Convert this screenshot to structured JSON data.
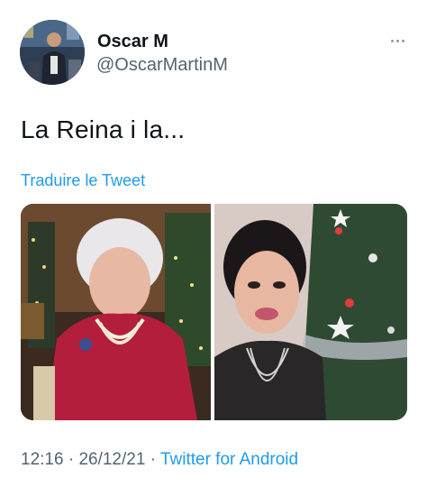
{
  "author": {
    "name": "Oscar M",
    "handle": "@OscarMartinM"
  },
  "tweet": {
    "text": "La Reina i la...",
    "translate_label": "Traduire le Tweet"
  },
  "footer": {
    "time": "12:16",
    "separator": " · ",
    "date": "26/12/21",
    "source": "Twitter for Android"
  },
  "icons": {
    "more": "more-dots-icon"
  },
  "colors": {
    "link": "#1d9bf0",
    "secondary_text": "#536471",
    "primary_text": "#0f1419"
  }
}
